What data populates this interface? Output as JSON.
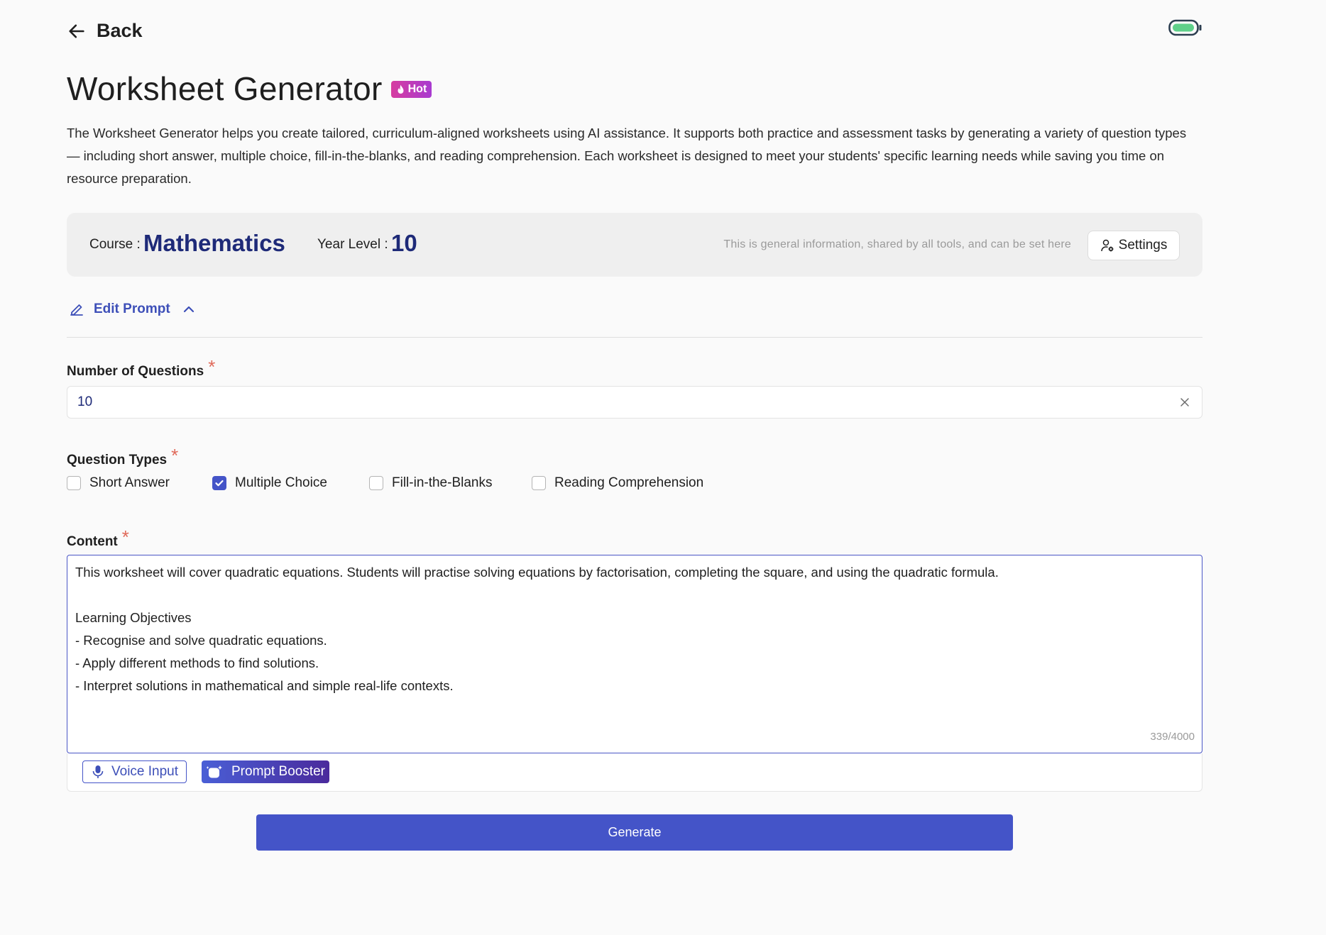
{
  "nav": {
    "back_label": "Back"
  },
  "header": {
    "title": "Worksheet Generator",
    "badge": "Hot",
    "description": "The Worksheet Generator helps you create tailored, curriculum-aligned worksheets using AI assistance. It supports both practice and assessment tasks by generating a variety of question types — including short answer, multiple choice, fill-in-the-blanks, and reading comprehension. Each worksheet is designed to meet your students' specific learning needs while saving you time on resource preparation."
  },
  "info": {
    "course_label": "Course :",
    "course_value": "Mathematics",
    "year_label": "Year Level :",
    "year_value": "10",
    "note": "This is general information, shared by all tools, and can be set here",
    "settings_label": "Settings"
  },
  "edit_prompt": {
    "label": "Edit Prompt"
  },
  "form": {
    "num_questions": {
      "label": "Number of Questions",
      "required_mark": "*",
      "value": "10"
    },
    "question_types": {
      "label": "Question Types",
      "required_mark": "*",
      "options": [
        {
          "label": "Short Answer",
          "checked": false
        },
        {
          "label": "Multiple Choice",
          "checked": true
        },
        {
          "label": "Fill-in-the-Blanks",
          "checked": false
        },
        {
          "label": "Reading Comprehension",
          "checked": false
        }
      ]
    },
    "content": {
      "label": "Content",
      "required_mark": "*",
      "value": "This worksheet will cover quadratic equations. Students will practise solving equations by factorisation, completing the square, and using the quadratic formula.\n\nLearning Objectives\n- Recognise and solve quadratic equations.\n- Apply different methods to find solutions.\n- Interpret solutions in mathematical and simple real-life contexts.",
      "counter": "339/4000"
    },
    "voice_input_label": "Voice Input",
    "prompt_booster_label": "Prompt Booster",
    "generate_label": "Generate"
  },
  "colors": {
    "accent": "#4454c8",
    "value_navy": "#1e2a78",
    "required": "#e06a5a",
    "hot_gradient_start": "#d63ca0",
    "hot_gradient_end": "#a83ad0",
    "battery_fill": "#5fd08a"
  },
  "icons": {
    "back": "arrow-left-icon",
    "badge": "flame-icon",
    "settings": "user-gear-icon",
    "edit": "pencil-icon",
    "collapse": "chevron-up-icon",
    "clear": "close-icon",
    "voice": "microphone-icon",
    "booster": "magic-sparkle-icon",
    "battery": "battery-icon"
  }
}
